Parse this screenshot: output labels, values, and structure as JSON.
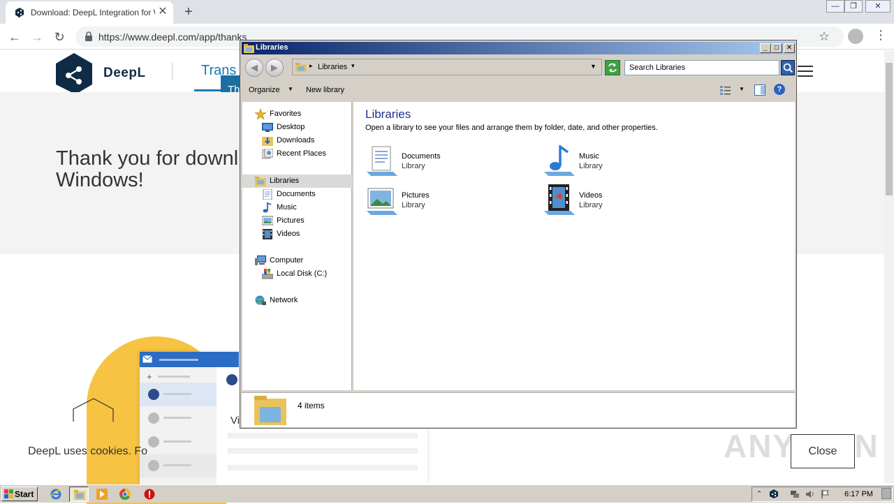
{
  "browser": {
    "tab_title": "Download: DeepL Integration for Wi",
    "tab_close": "✕",
    "new_tab": "+",
    "url": "https://www.deepl.com/app/thanks",
    "back": "←",
    "forward": "→",
    "reload": "↻",
    "bookmark_star": "☆",
    "menu": "⋮",
    "window_controls": {
      "minimize": "—",
      "restore": "❐",
      "close": "✕"
    }
  },
  "deepl": {
    "brand": "DeepL",
    "nav_translator": "Trans",
    "tooltip_chip": "Th",
    "hero_title_line1": "Thank you for downl",
    "hero_title_line2": "Windows!",
    "cookie_text": "DeepL uses cookies. Fo",
    "mail_preview_text": "Vi",
    "close_button": "Close",
    "watermark": "ANY  RUN"
  },
  "explorer": {
    "title": "Libraries",
    "title_buttons": {
      "minimize": "_",
      "maximize": "□",
      "close": "✕"
    },
    "back": "◀",
    "forward": "▶",
    "address_crumb": "Libraries",
    "search_placeholder": "Search Libraries",
    "commands": {
      "organize": "Organize",
      "new_library": "New library",
      "help": "?"
    },
    "nav": {
      "favorites": "Favorites",
      "desktop": "Desktop",
      "downloads": "Downloads",
      "recent_places": "Recent Places",
      "libraries": "Libraries",
      "documents": "Documents",
      "music": "Music",
      "pictures": "Pictures",
      "videos": "Videos",
      "computer": "Computer",
      "local_disk": "Local Disk (C:)",
      "network": "Network"
    },
    "content_title": "Libraries",
    "content_subtitle": "Open a library to see your files and arrange them by folder, date, and other properties.",
    "libraries": [
      {
        "name": "Documents",
        "type": "Library"
      },
      {
        "name": "Music",
        "type": "Library"
      },
      {
        "name": "Pictures",
        "type": "Library"
      },
      {
        "name": "Videos",
        "type": "Library"
      }
    ],
    "details_count": "4 items"
  },
  "taskbar": {
    "start": "Start",
    "clock": "6:17 PM"
  },
  "colors": {
    "deepl_navy": "#0f2b46",
    "deepl_blue": "#0f7ab8",
    "explorer_title_gradient_start": "#0a246a",
    "library_title": "#1e3287"
  }
}
